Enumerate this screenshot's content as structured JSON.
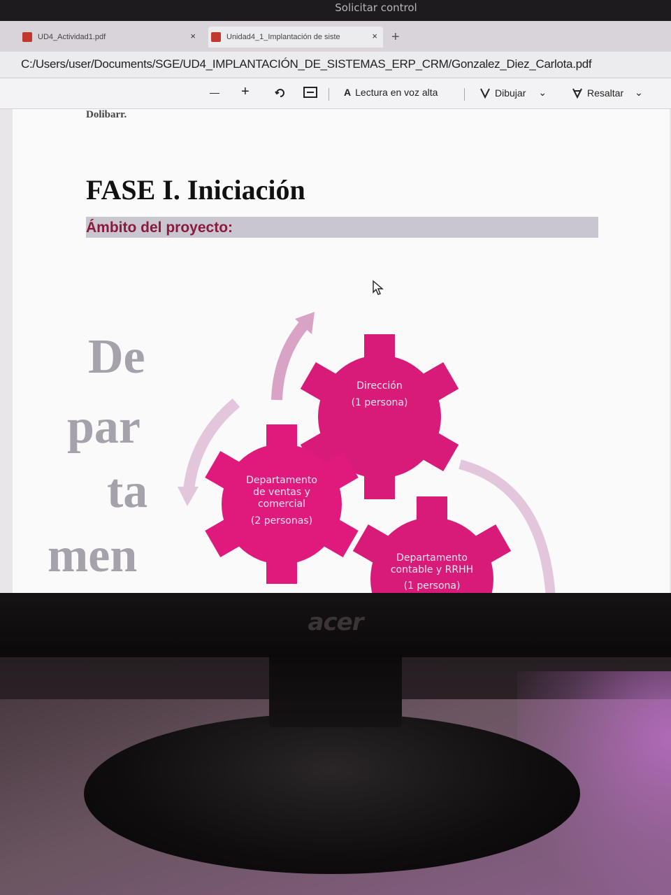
{
  "window": {
    "title": "Solicitar control"
  },
  "tabs": [
    {
      "label": "UD4_Actividad1.pdf",
      "close": "×"
    },
    {
      "label": "Unidad4_1_Implantación de siste",
      "close": "×"
    }
  ],
  "new_tab": "+",
  "address": {
    "path": "C:/Users/user/Documents/SGE/UD4_IMPLANTACIÓN_DE_SISTEMAS_ERP_CRM/Gonzalez_Diez_Carlota.pdf"
  },
  "toolbar": {
    "zoom_out": "—",
    "zoom_in": "+",
    "read_aloud": "Lectura en voz alta",
    "read_aloud_icon": "A",
    "draw": "Dibujar",
    "highlight": "Resaltar"
  },
  "document": {
    "top_cut_text": "Dolibarr.",
    "heading": "FASE I. Iniciación",
    "section_label": "Ámbito del proyecto:",
    "vertical_word": [
      "De",
      "par",
      "ta",
      "men"
    ],
    "gears": [
      {
        "name": "Dirección",
        "detail": "(1 persona)"
      },
      {
        "name_lines": [
          "Departamento",
          "de ventas y",
          "comercial"
        ],
        "detail": "(2 personas)"
      },
      {
        "name_lines": [
          "Departamento",
          "contable y RRHH"
        ],
        "detail": "(1 persona)"
      }
    ]
  },
  "monitor": {
    "brand": "acer"
  },
  "colors": {
    "gear_magenta": "#d81b78",
    "arrow_pink": "#d9a3c6",
    "heading_accent": "#8a1a3c",
    "scope_bar": "#cac6cf"
  }
}
